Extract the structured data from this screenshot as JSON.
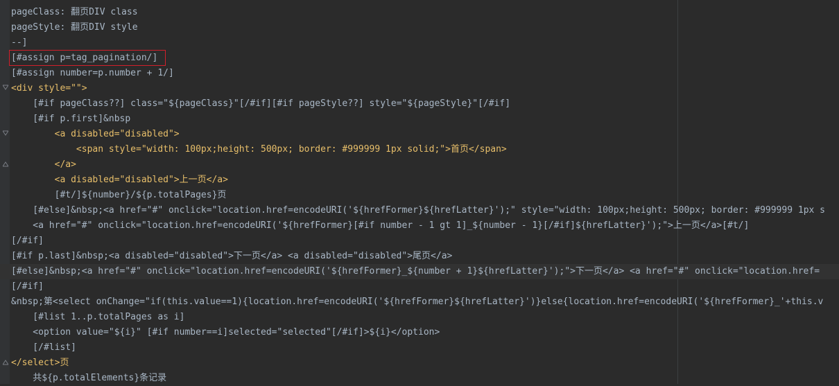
{
  "lines": [
    "pageClass: 翻页DIV class",
    "pageStyle: 翻页DIV style",
    "--]",
    "[#assign p=tag_pagination/]",
    "[#assign number=p.number + 1/]",
    "<div style=\"\">",
    "    [#if pageClass??] class=\"${pageClass}\"[/#if][#if pageStyle??] style=\"${pageStyle}\"[/#if]",
    "    [#if p.first]&nbsp",
    "        <a disabled=\"disabled\">",
    "            <span style=\"width: 100px;height: 500px; border: #999999 1px solid;\">首页</span>",
    "        </a>",
    "        <a disabled=\"disabled\">上一页</a>",
    "        [#t/]${number}/${p.totalPages}页",
    "    [#else]&nbsp;<a href=\"#\" onclick=\"location.href=encodeURI('${hrefFormer}${hrefLatter}');\" style=\"width: 100px;height: 500px; border: #999999 1px s",
    "    <a href=\"#\" onclick=\"location.href=encodeURI('${hrefFormer}[#if number - 1 gt 1]_${number - 1}[/#if]${hrefLatter}');\">上一页</a>[#t/]",
    "[/#if]",
    "[#if p.last]&nbsp;<a disabled=\"disabled\">下一页</a> <a disabled=\"disabled\">尾页</a>",
    "[#else]&nbsp;<a href=\"#\" onclick=\"location.href=encodeURI('${hrefFormer}_${number + 1}${hrefLatter}');\">下一页</a> <a href=\"#\" onclick=\"location.href=",
    "[/#if]",
    "&nbsp;第<select onChange=\"if(this.value==1){location.href=encodeURI('${hrefFormer}${hrefLatter}')}else{location.href=encodeURI('${hrefFormer}_'+this.v",
    "    [#list 1..p.totalPages as i]",
    "    <option value=\"${i}\" [#if number==i]selected=\"selected\"[/#if]>${i}</option>",
    "    [/#list]",
    "</select>页",
    "    共${p.totalElements}条记录"
  ],
  "highlighted_line_index": 3,
  "current_line_index": 17
}
